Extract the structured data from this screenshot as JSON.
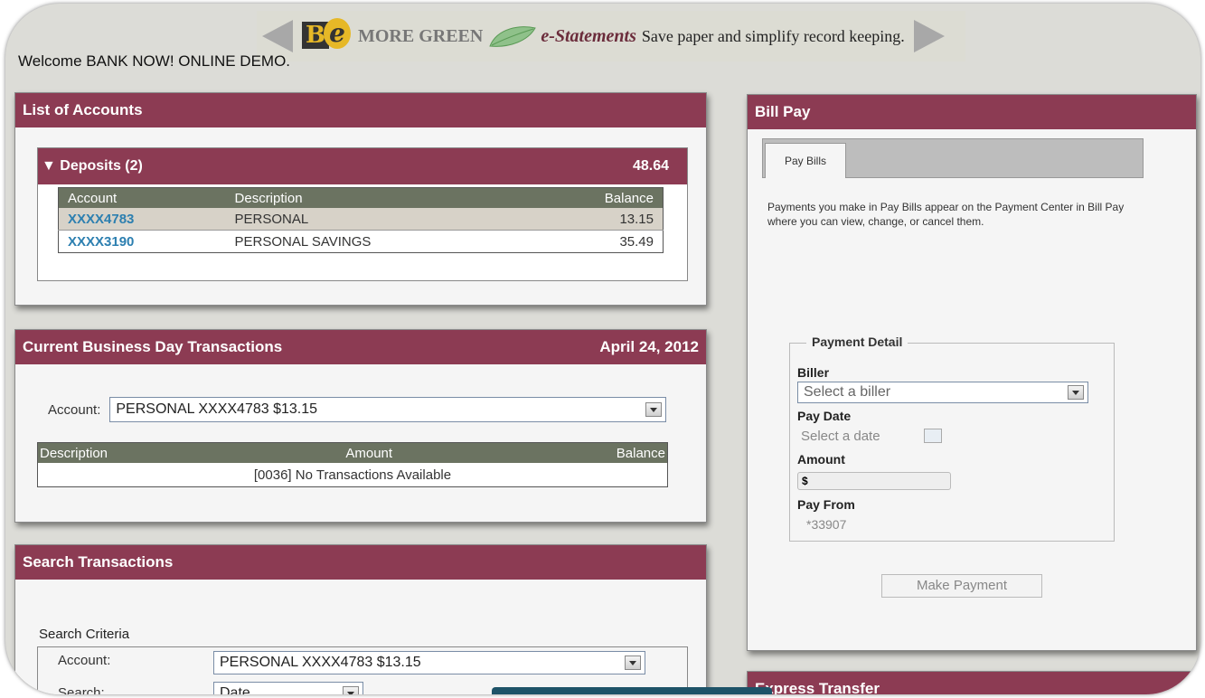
{
  "banner": {
    "logo_b": "B",
    "logo_e": "e",
    "more_green": "MORE GREEN",
    "estatements": "e-Statements",
    "tagline": "Save paper and simplify record keeping."
  },
  "welcome": "Welcome BANK NOW! ONLINE DEMO.",
  "accounts": {
    "title": "List of Accounts",
    "group_label": "▼ Deposits (2)",
    "group_total": "48.64",
    "columns": [
      "Account",
      "Description",
      "Balance"
    ],
    "rows": [
      {
        "account": "XXXX4783",
        "description": "PERSONAL",
        "balance": "13.15"
      },
      {
        "account": "XXXX3190",
        "description": "PERSONAL SAVINGS",
        "balance": "35.49"
      }
    ]
  },
  "cbd": {
    "title": "Current Business Day Transactions",
    "date": "April 24, 2012",
    "account_label": "Account:",
    "account_value": "PERSONAL XXXX4783 $13.15",
    "columns": [
      "Description",
      "Amount",
      "Balance"
    ],
    "empty_message": "[0036] No Transactions Available"
  },
  "search": {
    "title": "Search Transactions",
    "criteria_label": "Search Criteria",
    "account_label": "Account:",
    "account_value": "PERSONAL XXXX4783 $13.15",
    "search_label": "Search:",
    "search_value": "Date"
  },
  "billpay": {
    "title": "Bill Pay",
    "tab": "Pay Bills",
    "info": "Payments you make in Pay Bills appear on the Payment Center in Bill Pay where you can view, change, or cancel them.",
    "legend": "Payment Detail",
    "biller_label": "Biller",
    "biller_value": "Select a biller",
    "paydate_label": "Pay Date",
    "paydate_value": "Select a date",
    "amount_label": "Amount",
    "amount_value": "$",
    "payfrom_label": "Pay From",
    "payfrom_value": "*33907",
    "button": "Make Payment"
  },
  "express": {
    "title": "Express Transfer"
  },
  "colors": {
    "header": "#8c3b53",
    "table_header": "#6b7361",
    "link": "#2c7fb0",
    "background": "#dcdcd7"
  }
}
